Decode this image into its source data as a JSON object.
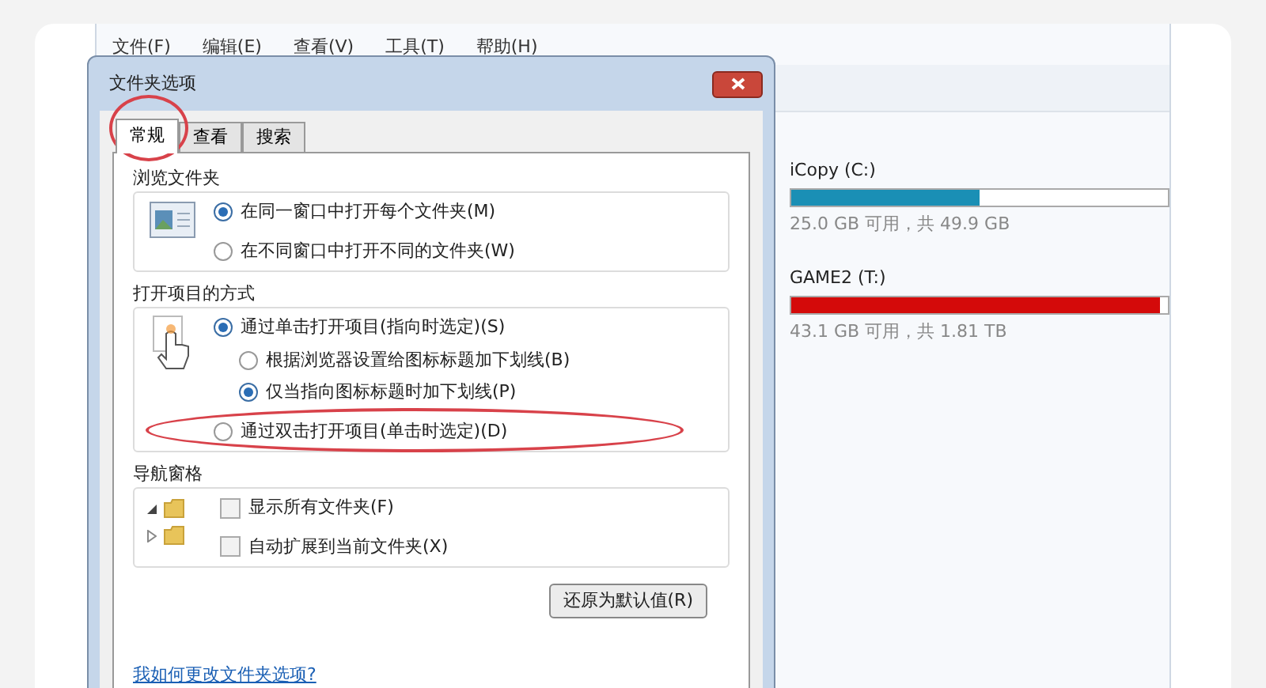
{
  "menu": [
    "文件(F)",
    "编辑(E)",
    "查看(V)",
    "工具(T)",
    "帮助(H)"
  ],
  "dialog": {
    "title": "文件夹选项",
    "tabs": [
      {
        "label": "常规",
        "selected": true
      },
      {
        "label": "查看",
        "selected": false
      },
      {
        "label": "搜索",
        "selected": false
      }
    ],
    "groups": [
      {
        "title": "浏览文件夹",
        "kind": "radio",
        "options": [
          {
            "label": "在同一窗口中打开每个文件夹(M)",
            "selected": true
          },
          {
            "label": "在不同窗口中打开不同的文件夹(W)",
            "selected": false
          }
        ]
      },
      {
        "title": "打开项目的方式",
        "kind": "radio",
        "options": [
          {
            "label": "通过单击打开项目(指向时选定)(S)",
            "selected": true,
            "children": [
              {
                "label": "根据浏览器设置给图标标题加下划线(B)",
                "selected": false
              },
              {
                "label": "仅当指向图标标题时加下划线(P)",
                "selected": true
              }
            ]
          },
          {
            "label": "通过双击打开项目(单击时选定)(D)",
            "selected": false
          }
        ]
      },
      {
        "title": "导航窗格",
        "kind": "checkbox",
        "options": [
          {
            "label": "显示所有文件夹(F)",
            "checked": false
          },
          {
            "label": "自动扩展到当前文件夹(X)",
            "checked": false
          }
        ]
      }
    ],
    "restore_button": "还原为默认值(R)",
    "help_link": "我如何更改文件夹选项?"
  },
  "drives": [
    {
      "name": "iCopy (C:)",
      "level": 0.5,
      "color": "#1a8fb5",
      "usage": "25.0 GB 可用，共 49.9 GB"
    },
    {
      "name": "GAME2 (T:)",
      "level": 0.98,
      "color": "#d40a0a",
      "usage": "43.1 GB 可用，共 1.81 TB"
    }
  ]
}
